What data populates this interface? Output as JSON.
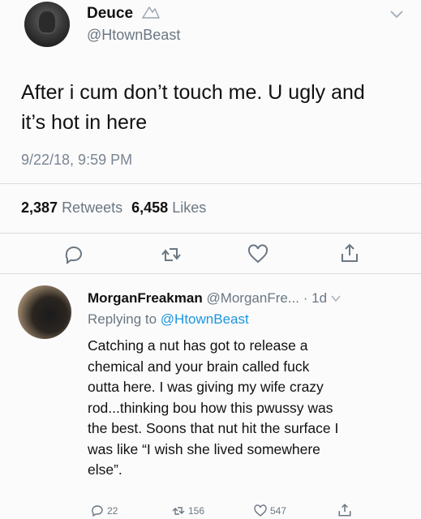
{
  "tweet": {
    "author_name": "Deuce",
    "author_handle": "@HtownBeast",
    "text_line1": "After i cum don’t touch me. U ugly and",
    "text_line2": "it’s hot in here",
    "timestamp": "9/22/18, 9:59 PM",
    "retweets_count": "2,387",
    "retweets_label": "Retweets",
    "likes_count": "6,458",
    "likes_label": "Likes",
    "icons": [
      "reply-icon",
      "retweet-icon",
      "like-icon",
      "share-icon",
      "chevron-down-icon"
    ]
  },
  "reply": {
    "author_name": "MorganFreakman",
    "author_handle": "@MorganFre...",
    "age": "· 1d",
    "replying_prefix": "Replying to",
    "replying_handle": "@HtownBeast",
    "lines": [
      "Catching a nut has got to release a",
      "chemical and your brain called fuck",
      "outta here. I was giving my wife crazy",
      "rod...thinking bou how this pwussy was",
      "the best. Soons that nut hit the surface I",
      "was like “I wish she lived somewhere",
      "else”."
    ],
    "reply_count": "22",
    "retweet_count": "156",
    "like_count": "547"
  },
  "colors": {
    "background": "#fbfbfb",
    "text": "#111111",
    "muted": "#6b7783",
    "link": "#1b95e0",
    "divider": "#d8dde2"
  }
}
